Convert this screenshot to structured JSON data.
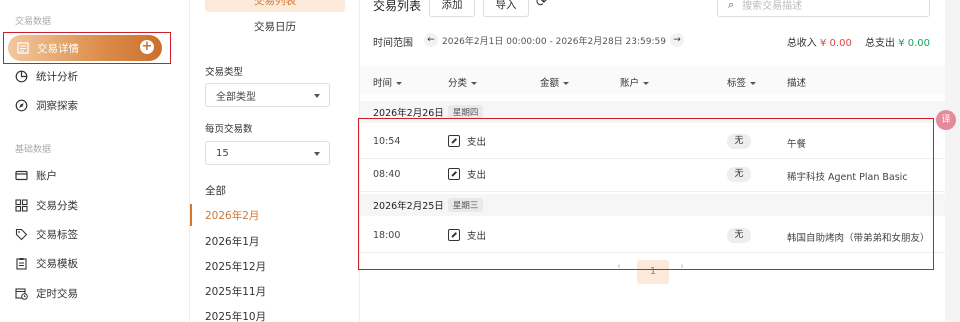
{
  "sidebar": {
    "section_trade": "交易数据",
    "active_item": "交易详情",
    "items_trade": [
      "统计分析",
      "洞察探索"
    ],
    "section_base": "基础数据",
    "items_base": [
      "账户",
      "交易分类",
      "交易标签",
      "交易模板",
      "定时交易"
    ]
  },
  "middle": {
    "tab_list": "交易列表",
    "tab_calendar": "交易日历",
    "type_label": "交易类型",
    "type_value": "全部类型",
    "pagesize_label": "每页交易数",
    "pagesize_value": "15",
    "months": [
      "全部",
      "2026年2月",
      "2026年1月",
      "2025年12月",
      "2025年11月",
      "2025年10月"
    ]
  },
  "main": {
    "title": "交易列表",
    "add_button": "添加",
    "import_button": "导入",
    "search_placeholder": "搜索交易描述",
    "range_label": "时间范围",
    "range_value": "2026年2月1日 00:00:00 - 2026年2月28日 23:59:59",
    "income_label": "总收入",
    "income_value": "¥ 0.00",
    "expense_label": "总支出",
    "expense_value": "¥ 0.00",
    "columns": [
      "时间",
      "分类",
      "金额",
      "账户",
      "标签",
      "描述"
    ],
    "groups": [
      {
        "date": "2026年2月26日",
        "weekday": "星期四",
        "rows": [
          {
            "time": "10:54",
            "category": "支出",
            "tag": "无",
            "desc": "午餐"
          },
          {
            "time": "08:40",
            "category": "支出",
            "tag": "无",
            "desc": "稀宇科技 Agent Plan Basic"
          }
        ]
      },
      {
        "date": "2026年2月25日",
        "weekday": "星期三",
        "rows": [
          {
            "time": "18:00",
            "category": "支出",
            "tag": "无",
            "desc": "韩国自助烤肉（带弟弟和女朋友）"
          }
        ]
      }
    ],
    "pager_prev": "‹",
    "pager_current": "1",
    "pager_next": "›"
  },
  "side_badge": "译",
  "colors": {
    "accent": "#d4762e",
    "income": "#e04545",
    "expense": "#1aa35a",
    "highlight_box": "#cc1f2a"
  }
}
